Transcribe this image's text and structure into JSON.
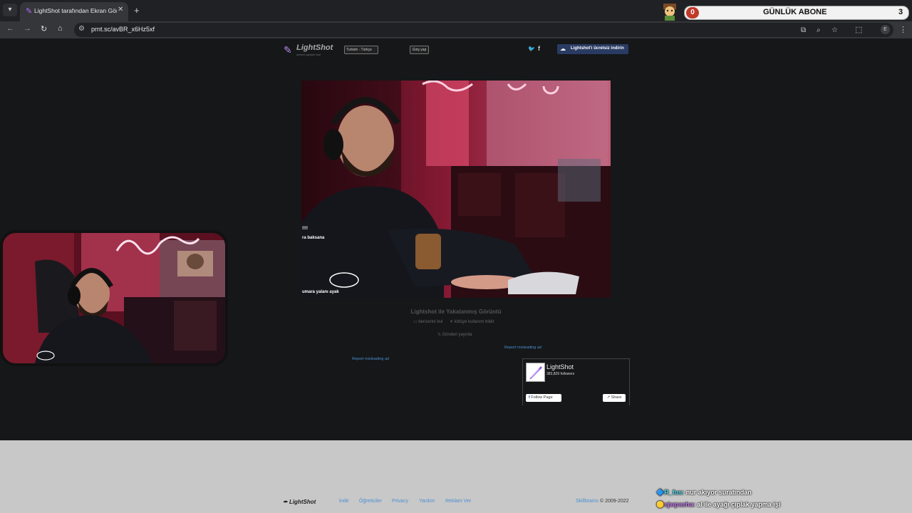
{
  "browser": {
    "tab_title": "LightShot tarafından Ekran Görüntüsü",
    "url": "prnt.sc/avBR_x6Hz5xf",
    "profile_initial": "E"
  },
  "overlay": {
    "left_count": "0",
    "label": "GÜNLÜK ABONE",
    "right_count": "3"
  },
  "lightshot": {
    "logo": "LightShot",
    "logo_sub": "screen capture tool",
    "language": "Turkish - Türkçe",
    "login": "Giriş yap",
    "download": "Lightshot'ı ücretsiz indirin",
    "image_captions": [
      "!!!!",
      "ra baksana",
      "umara yalanı ayak"
    ],
    "image_title": "Lightshot ile Yakalanmış Görüntü",
    "similar": "benzerini bul",
    "report_abuse": "kötüye kullanım bildir",
    "post_to_x": "Gönderi yayınla",
    "report_ad": "Report misleading ad",
    "fb_widget": {
      "name": "LightShot",
      "followers": "383,829 followers",
      "follow": "Follow Page",
      "share": "Share"
    },
    "footer": {
      "logo": "LightShot",
      "links": [
        "İndir",
        "Öğreticiler",
        "Privacy",
        "Yardım",
        "Reklam Ver"
      ],
      "copyright_brand": "Skillbrains",
      "copyright": "© 2009-2022"
    }
  },
  "chat": [
    {
      "user": "R_fus:",
      "message": "nur akıyor suratından"
    },
    {
      "user": "sjwpasha:",
      "message": "al ile ayağı çıplak yapma işi"
    }
  ],
  "colors": {
    "page_bg": "#151719",
    "footer_bg": "#c8c8c8",
    "link": "#4a8fd1",
    "download_btn": "#2a3b63",
    "accent_red": "#c0392b"
  }
}
